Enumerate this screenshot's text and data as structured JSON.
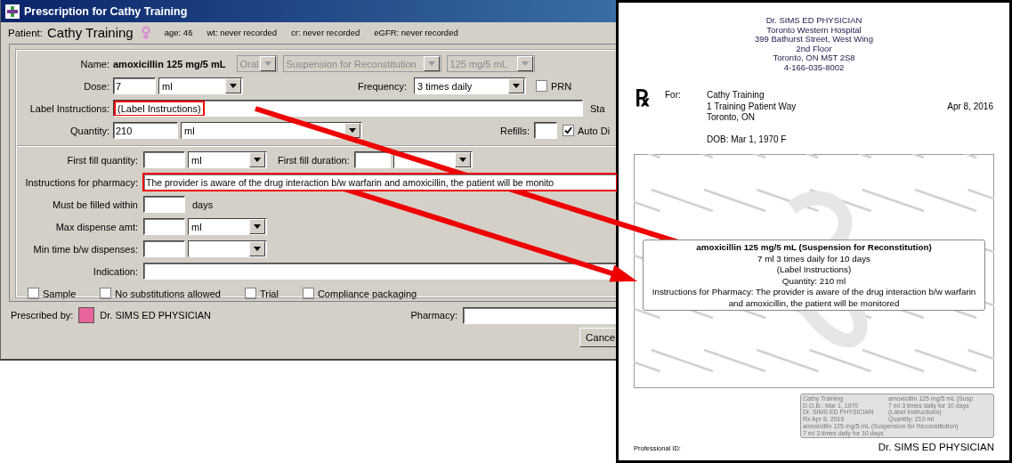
{
  "window": {
    "title": "Prescription for Cathy Training"
  },
  "patient": {
    "label": "Patient:",
    "name": "Cathy Training",
    "age": "age: 46",
    "wt": "wt: never recorded",
    "cr": "cr: never recorded",
    "egfr": "eGFR: never recorded"
  },
  "name_row": {
    "label": "Name:",
    "drug": "amoxicillin 125 mg/5 mL",
    "selects": [
      {
        "value": "Oral",
        "disabled": true
      },
      {
        "value": "Suspension for Reconstitution",
        "disabled": true
      },
      {
        "value": "125 mg/5 mL",
        "disabled": true
      }
    ]
  },
  "dose": {
    "label": "Dose:",
    "value": "7",
    "unit": "ml"
  },
  "frequency": {
    "label": "Frequency:",
    "value": "3 times daily"
  },
  "prn": {
    "label": "PRN",
    "checked": false
  },
  "label_instructions": {
    "label": "Label Instructions:",
    "value": "(Label Instructions)",
    "highlighted": true,
    "side_label": "Sta"
  },
  "quantity": {
    "label": "Quantity:",
    "value": "210",
    "unit": "ml"
  },
  "refills": {
    "label": "Refills:"
  },
  "auto_dispense": {
    "label": "Auto Di",
    "checked": true
  },
  "first_fill_quantity": {
    "label": "First fill quantity:",
    "unit": "ml"
  },
  "first_fill_duration": {
    "label": "First fill duration:"
  },
  "pharmacy_instructions": {
    "label": "Instructions for pharmacy:",
    "value": "The provider is aware of the drug interaction b/w warfarin and amoxicillin, the patient will be monito",
    "highlighted": true
  },
  "filled_within": {
    "label": "Must be filled within",
    "suffix": "days"
  },
  "max_dispense": {
    "label": "Max dispense amt:",
    "unit": "ml"
  },
  "min_time": {
    "label": "Min time b/w dispenses:"
  },
  "indication": {
    "label": "Indication:"
  },
  "options": [
    {
      "label": "Sample",
      "checked": false
    },
    {
      "label": "No substitutions allowed",
      "checked": false
    },
    {
      "label": "Trial",
      "checked": false
    },
    {
      "label": "Compliance packaging",
      "checked": false
    }
  ],
  "prescriber": {
    "label": "Prescribed by:",
    "name": "Dr. SIMS ED PHYSICIAN",
    "color": "#e8649c"
  },
  "pharmacy": {
    "label": "Pharmacy:"
  },
  "buttons": [
    {
      "label": "Cance"
    }
  ],
  "document": {
    "header": [
      "Dr. SIMS ED PHYSICIAN",
      "Toronto Western Hospital",
      "399 Bathurst Street, West Wing",
      "2nd Floor",
      "Toronto, ON  M5T 2S8",
      "4-166-035-8002"
    ],
    "rx": "℞",
    "for_label": "For:",
    "patient_lines": [
      "Cathy Training",
      "1 Training Patient Way",
      "Toronto, ON"
    ],
    "dob": "DOB: Mar 1, 1970  F",
    "date": "Apr 8, 2016",
    "label": {
      "title": "amoxicillin 125 mg/5 mL (Suspension for Reconstitution)",
      "lines": [
        "7 ml 3 times daily for 10 days",
        "(Label Instructions)",
        "Quantity: 210 ml",
        "Instructions for Pharmacy: The provider is aware of the drug interaction b/w warfarin and amoxicillin, the patient will be monitored"
      ]
    },
    "small_label": {
      "left": [
        "Cathy Training",
        "D.O.B.: Mar 1, 1970",
        "Dr. SIMS ED PHYSICIAN",
        "Rx Apr 8, 2016"
      ],
      "right": [
        "amoxicillin 125 mg/5 mL (Susp",
        "7 ml 3 times daily for 10 days",
        "(Label Instructions)",
        "Quantity: 210 ml"
      ],
      "bottom": [
        "amoxicillin 125 mg/5 mL (Suspension for Reconstitution)",
        "7 ml 3 times daily for 10 days"
      ]
    },
    "professional_id": "Professional ID:",
    "signature": "Dr. SIMS ED PHYSICIAN"
  }
}
